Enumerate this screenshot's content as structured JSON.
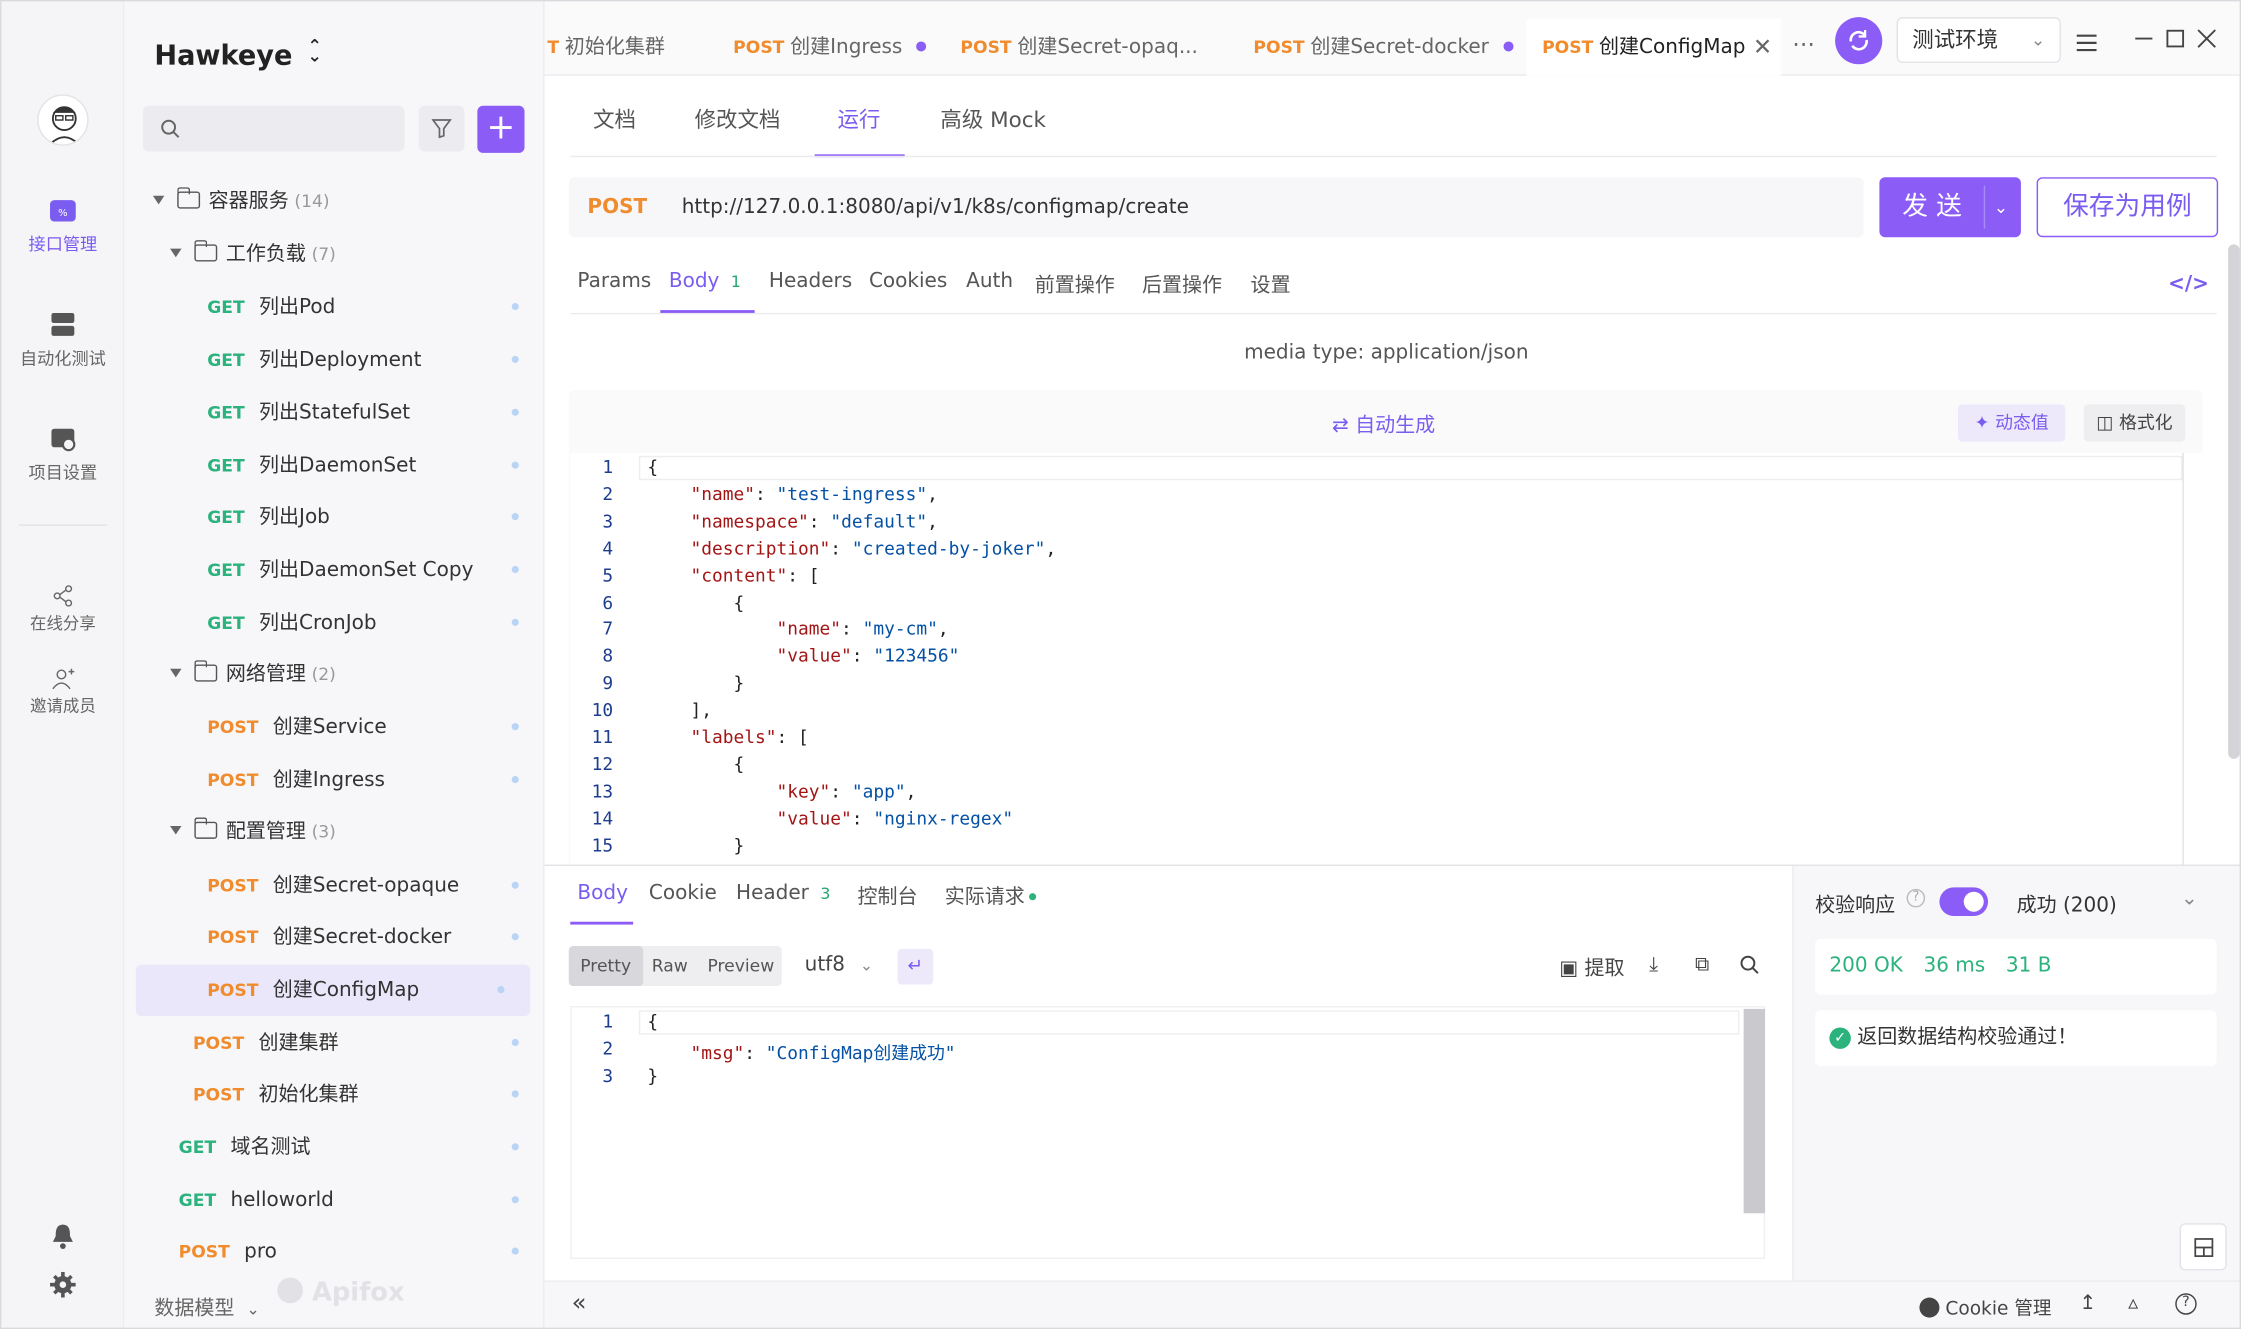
{
  "app": {
    "project": "Hawkeye",
    "brand": "Apifox",
    "accent": "#8b5cf6"
  },
  "rail": {
    "api": "接口管理",
    "auto": "自动化测试",
    "settings": "项目设置",
    "share": "在线分享",
    "invite": "邀请成员"
  },
  "tree": [
    {
      "kind": "folder",
      "label": "容器服务",
      "count": "(14)"
    },
    {
      "kind": "folder",
      "label": "工作负载",
      "count": "(7)"
    },
    {
      "kind": "api",
      "method": "GET",
      "label": "列出Pod"
    },
    {
      "kind": "api",
      "method": "GET",
      "label": "列出Deployment"
    },
    {
      "kind": "api",
      "method": "GET",
      "label": "列出StatefulSet"
    },
    {
      "kind": "api",
      "method": "GET",
      "label": "列出DaemonSet"
    },
    {
      "kind": "api",
      "method": "GET",
      "label": "列出Job"
    },
    {
      "kind": "api",
      "method": "GET",
      "label": "列出DaemonSet Copy"
    },
    {
      "kind": "api",
      "method": "GET",
      "label": "列出CronJob"
    },
    {
      "kind": "folder",
      "label": "网络管理",
      "count": "(2)"
    },
    {
      "kind": "api",
      "method": "POST",
      "label": "创建Service"
    },
    {
      "kind": "api",
      "method": "POST",
      "label": "创建Ingress"
    },
    {
      "kind": "folder",
      "label": "配置管理",
      "count": "(3)"
    },
    {
      "kind": "api",
      "method": "POST",
      "label": "创建Secret-opaque"
    },
    {
      "kind": "api",
      "method": "POST",
      "label": "创建Secret-docker"
    },
    {
      "kind": "api",
      "method": "POST",
      "label": "创建ConfigMap"
    },
    {
      "kind": "api",
      "method": "POST",
      "label": "创建集群"
    },
    {
      "kind": "api",
      "method": "POST",
      "label": "初始化集群"
    },
    {
      "kind": "api",
      "method": "GET",
      "label": "域名测试"
    },
    {
      "kind": "api",
      "method": "GET",
      "label": "helloworld"
    },
    {
      "kind": "api",
      "method": "POST",
      "label": "pro"
    }
  ],
  "sidebar": {
    "data_model": "数据模型"
  },
  "tabs": [
    {
      "method": "T",
      "label": "初始化集群"
    },
    {
      "method": "POST",
      "label": "创建Ingress"
    },
    {
      "method": "POST",
      "label": "创建Secret-opaq..."
    },
    {
      "method": "POST",
      "label": "创建Secret-docker"
    },
    {
      "method": "POST",
      "label": "创建ConfigMap"
    }
  ],
  "env": "测试环境",
  "subtabs": [
    "文档",
    "修改文档",
    "运行",
    "高级 Mock"
  ],
  "request": {
    "method": "POST",
    "url": "http://127.0.0.1:8080/api/v1/k8s/configmap/create",
    "send": "发 送",
    "save_as": "保存为用例"
  },
  "param_tabs": [
    "Params",
    "Body",
    "Headers",
    "Cookies",
    "Auth",
    "前置操作",
    "后置操作",
    "设置"
  ],
  "body_count": "1",
  "media_type": "media type: application/json",
  "auto_gen": "自动生成",
  "dynamic": "动态值",
  "format": "格式化",
  "code_lines": [
    {
      "n": "1",
      "t": "{"
    },
    {
      "n": "2",
      "t": "    \"name\": \"test-ingress\","
    },
    {
      "n": "3",
      "t": "    \"namespace\": \"default\","
    },
    {
      "n": "4",
      "t": "    \"description\": \"created-by-joker\","
    },
    {
      "n": "5",
      "t": "    \"content\": ["
    },
    {
      "n": "6",
      "t": "        {"
    },
    {
      "n": "7",
      "t": "            \"name\": \"my-cm\","
    },
    {
      "n": "8",
      "t": "            \"value\": \"123456\""
    },
    {
      "n": "9",
      "t": "        }"
    },
    {
      "n": "10",
      "t": "    ],"
    },
    {
      "n": "11",
      "t": "    \"labels\": ["
    },
    {
      "n": "12",
      "t": "        {"
    },
    {
      "n": "13",
      "t": "            \"key\": \"app\","
    },
    {
      "n": "14",
      "t": "            \"value\": \"nginx-regex\""
    },
    {
      "n": "15",
      "t": "        }"
    }
  ],
  "resp_tabs": [
    "Body",
    "Cookie",
    "Header",
    "控制台",
    "实际请求"
  ],
  "header_count": "3",
  "resp_buttons": {
    "pretty": "Pretty",
    "raw": "Raw",
    "preview": "Preview",
    "encoding": "utf8",
    "extract": "提取"
  },
  "resp_lines": [
    {
      "n": "1",
      "t": "{"
    },
    {
      "n": "2",
      "t": "    \"msg\": \"ConfigMap创建成功\""
    },
    {
      "n": "3",
      "t": "}"
    }
  ],
  "validate": {
    "label": "校验响应",
    "result": "成功 (200)",
    "status": "200 OK",
    "time": "36 ms",
    "size": "31 B",
    "msg": "返回数据结构校验通过！"
  },
  "footer": {
    "cookie": "Cookie 管理"
  }
}
